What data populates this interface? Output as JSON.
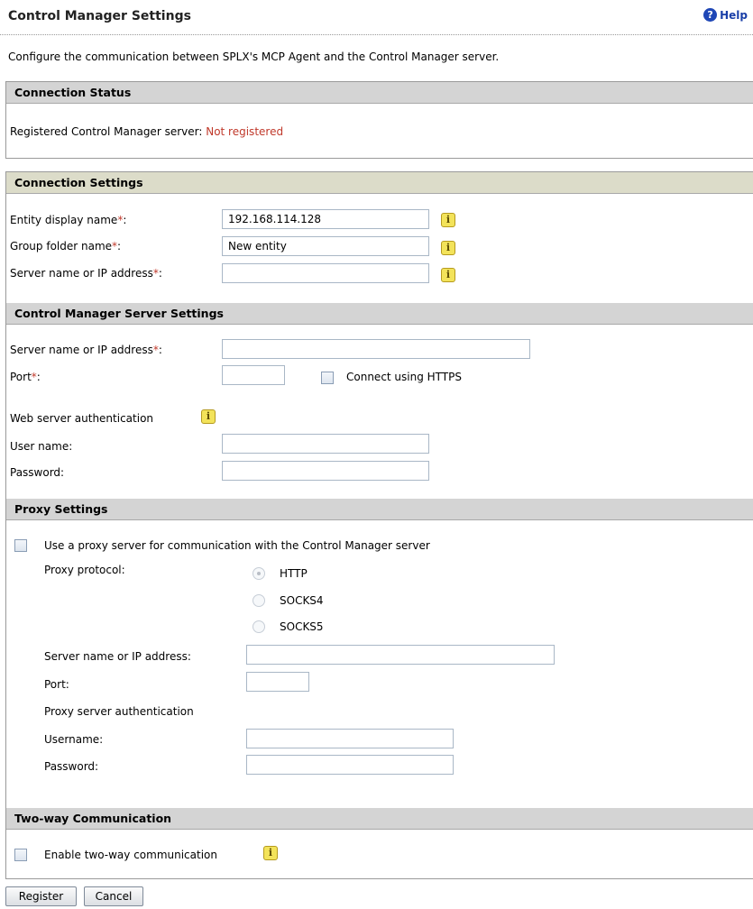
{
  "header": {
    "title": "Control Manager Settings",
    "help_label": "Help",
    "help_icon": "question-icon"
  },
  "description": "Configure the communication between SPLX's MCP Agent and the Control Manager server.",
  "connection_status": {
    "heading": "Connection Status",
    "label": "Registered Control Manager server:",
    "value": "Not registered"
  },
  "connection_settings": {
    "heading": "Connection Settings",
    "entity_label": "Entity display name",
    "entity_value": "192.168.114.128",
    "group_label": "Group folder name",
    "group_value": "New entity",
    "server_label": "Server name or IP address",
    "server_value": ""
  },
  "cm_server": {
    "heading": "Control Manager Server Settings",
    "server_label": "Server name or IP address",
    "server_value": "",
    "port_label": "Port",
    "port_value": "",
    "https_label": "Connect using HTTPS",
    "https_checked": false,
    "auth_label": "Web server authentication",
    "user_label": "User name:",
    "user_value": "",
    "password_label": "Password:",
    "password_value": ""
  },
  "proxy": {
    "heading": "Proxy Settings",
    "use_proxy_label": "Use a proxy server for communication with the Control Manager server",
    "use_proxy_checked": false,
    "protocol_label": "Proxy protocol:",
    "protocols": [
      "HTTP",
      "SOCKS4",
      "SOCKS5"
    ],
    "selected_protocol": "HTTP",
    "server_label": "Server name or IP address:",
    "server_value": "",
    "port_label": "Port:",
    "port_value": "",
    "auth_label": "Proxy server authentication",
    "username_label": "Username:",
    "username_value": "",
    "password_label": "Password:",
    "password_value": ""
  },
  "two_way": {
    "heading": "Two-way Communication",
    "enable_label": "Enable two-way communication",
    "enable_checked": false
  },
  "buttons": {
    "register": "Register",
    "cancel": "Cancel"
  },
  "required_marker": "*",
  "colin": ":",
  "info_glyph": "i",
  "colors": {
    "required": "#c0392b",
    "status_not_registered": "#c0392b",
    "section_bar": "#d4d4d4",
    "section_bar_olive": "#dcdcc9"
  }
}
